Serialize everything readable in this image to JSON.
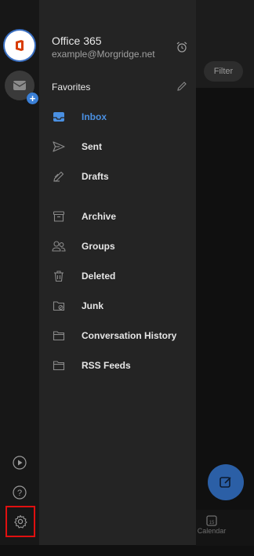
{
  "background": {
    "filter_label": "Filter",
    "calendar_label": "Calendar",
    "calendar_day": "15"
  },
  "account": {
    "name": "Office 365",
    "email": "example@Morgridge.net"
  },
  "favorites_label": "Favorites",
  "folders": [
    {
      "label": "Inbox",
      "icon": "inbox-icon",
      "selected": true
    },
    {
      "label": "Sent",
      "icon": "sent-icon"
    },
    {
      "label": "Drafts",
      "icon": "drafts-icon"
    },
    {
      "label": "Archive",
      "icon": "archive-icon"
    },
    {
      "label": "Groups",
      "icon": "groups-icon"
    },
    {
      "label": "Deleted",
      "icon": "trash-icon"
    },
    {
      "label": "Junk",
      "icon": "junk-icon"
    },
    {
      "label": "Conversation History",
      "icon": "folder-icon"
    },
    {
      "label": "RSS Feeds",
      "icon": "folder-icon"
    }
  ],
  "colors": {
    "accent": "#4a90e2",
    "panel": "#242424",
    "rail": "#171717",
    "highlight": "#e01010"
  }
}
